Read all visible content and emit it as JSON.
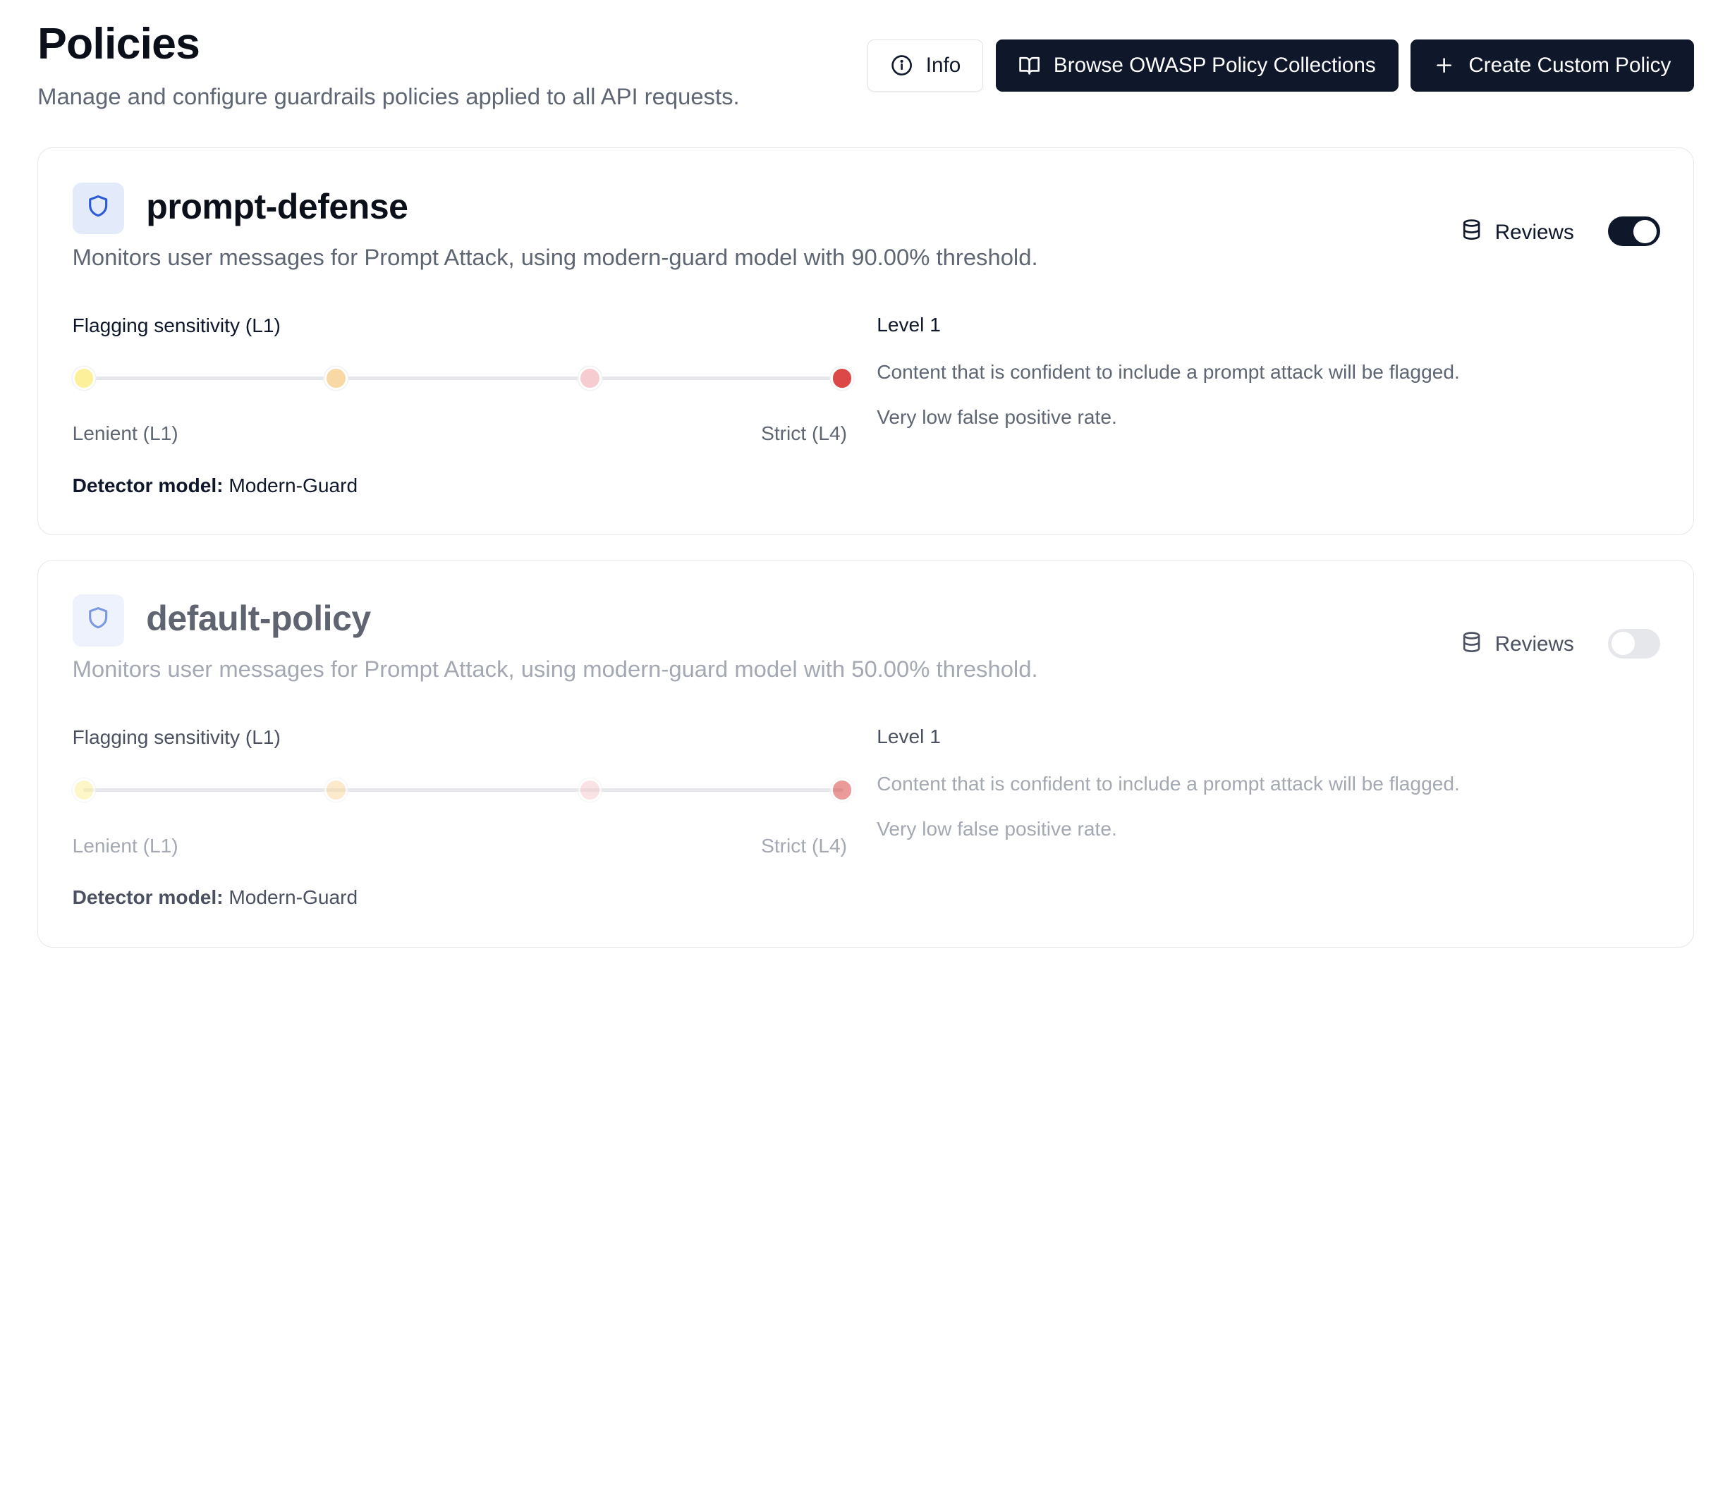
{
  "header": {
    "title": "Policies",
    "subtitle": "Manage and configure guardrails policies applied to all API requests.",
    "buttons": {
      "info_label": "Info",
      "browse_label": "Browse OWASP Policy Collections",
      "create_label": "Create Custom Policy"
    }
  },
  "policies": [
    {
      "name": "prompt-defense",
      "description": "Monitors user messages for Prompt Attack, using modern-guard model with 90.00% threshold.",
      "reviews_label": "Reviews",
      "enabled": true,
      "sensitivity_label": "Flagging sensitivity (L1)",
      "sensitivity_level": 1,
      "slider_colors": [
        "#fdf09a",
        "#f8d9a4",
        "#f7ccd0",
        "#dc4848"
      ],
      "range_left": "Lenient (L1)",
      "range_right": "Strict (L4)",
      "detector_label": "Detector model:",
      "detector_value": "Modern-Guard",
      "level_title": "Level 1",
      "level_line1": "Content that is confident to include a prompt attack will be flagged.",
      "level_line2": "Very low false positive rate."
    },
    {
      "name": "default-policy",
      "description": "Monitors user messages for Prompt Attack, using modern-guard model with 50.00% threshold.",
      "reviews_label": "Reviews",
      "enabled": false,
      "sensitivity_label": "Flagging sensitivity (L1)",
      "sensitivity_level": 1,
      "slider_colors": [
        "#fdf09a",
        "#f8d9a4",
        "#f7ccd0",
        "#dc4848"
      ],
      "range_left": "Lenient (L1)",
      "range_right": "Strict (L4)",
      "detector_label": "Detector model:",
      "detector_value": "Modern-Guard",
      "level_title": "Level 1",
      "level_line1": "Content that is confident to include a prompt attack will be flagged.",
      "level_line2": "Very low false positive rate."
    }
  ],
  "icons": {
    "info": "info-icon",
    "browse": "book-open-icon",
    "create": "plus-icon",
    "policy": "shield-icon",
    "reviews": "database-icon"
  },
  "colors": {
    "primary": "#0f172a",
    "shield_accent": "#2d5bd6",
    "muted_text": "#5f6673"
  }
}
